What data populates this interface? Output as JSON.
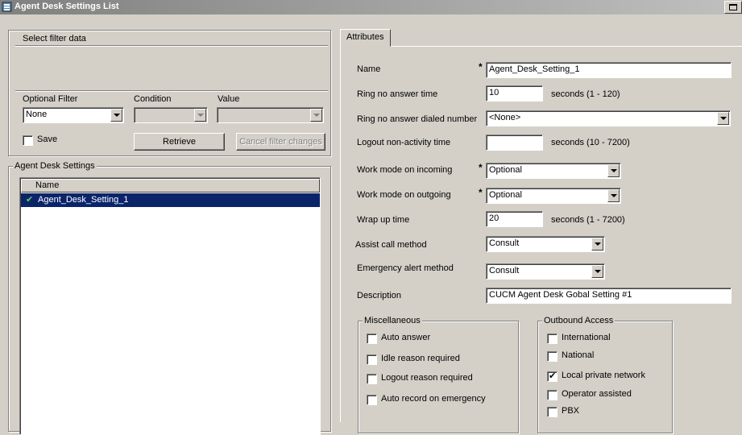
{
  "window": {
    "title": "Agent Desk Settings List"
  },
  "filter": {
    "title": "Select filter data",
    "optional_filter_label": "Optional Filter",
    "condition_label": "Condition",
    "value_label": "Value",
    "optional_filter_value": "None",
    "condition_value": "",
    "value_value": "",
    "save_label": "Save",
    "retrieve_label": "Retrieve",
    "cancel_label": "Cancel filter changes"
  },
  "list": {
    "group_label": "Agent Desk Settings",
    "column_name": "Name",
    "rows": [
      {
        "name": "Agent_Desk_Setting_1",
        "selected": true
      }
    ]
  },
  "tabs": [
    {
      "label": "Attributes",
      "active": true
    }
  ],
  "attributes": {
    "name_label": "Name",
    "name_value": "Agent_Desk_Setting_1",
    "rna_time_label": "Ring no answer time",
    "rna_time_value": "10",
    "rna_time_hint": "seconds (1 - 120)",
    "rna_dialed_label": "Ring no answer dialed number",
    "rna_dialed_value": "<None>",
    "logout_label": "Logout non-activity time",
    "logout_value": "",
    "logout_hint": "seconds (10 - 7200)",
    "wm_in_label": "Work mode on incoming",
    "wm_in_value": "Optional",
    "wm_out_label": "Work mode on outgoing",
    "wm_out_value": "Optional",
    "wrap_label": "Wrap up time",
    "wrap_value": "20",
    "wrap_hint": "seconds (1 - 7200)",
    "assist_label": "Assist call method",
    "assist_value": "Consult",
    "emergency_label": "Emergency alert method",
    "emergency_value": "Consult",
    "desc_label": "Description",
    "desc_value": "CUCM Agent Desk Gobal Setting #1",
    "required_mark": "*"
  },
  "misc": {
    "title": "Miscellaneous",
    "items": [
      {
        "label": "Auto answer",
        "checked": false
      },
      {
        "label": "Idle reason required",
        "checked": false
      },
      {
        "label": "Logout reason required",
        "checked": false
      },
      {
        "label": "Auto record on emergency",
        "checked": false
      }
    ]
  },
  "outbound": {
    "title": "Outbound Access",
    "items": [
      {
        "label": "International",
        "checked": false
      },
      {
        "label": "National",
        "checked": false
      },
      {
        "label": "Local private network",
        "checked": true
      },
      {
        "label": "Operator assisted",
        "checked": false
      },
      {
        "label": "PBX",
        "checked": false
      }
    ]
  },
  "colors": {
    "selection": "#0a246a",
    "check_green": "#1a8a1a"
  }
}
